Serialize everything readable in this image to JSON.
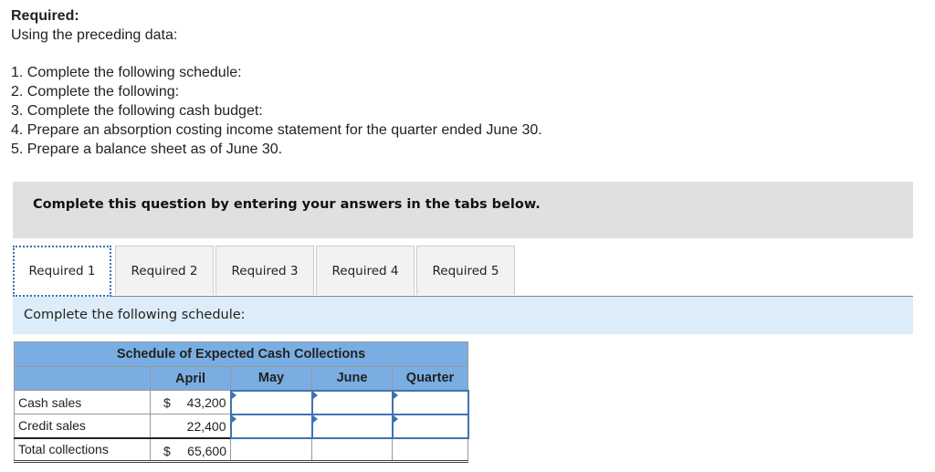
{
  "required": {
    "heading": "Required:",
    "intro": "Using the preceding data:",
    "items": [
      "1. Complete the following schedule:",
      "2. Complete the following:",
      "3. Complete the following cash budget:",
      "4. Prepare an absorption costing income statement for the quarter ended June 30.",
      "5. Prepare a balance sheet as of June 30."
    ]
  },
  "banner": "Complete this question by entering your answers in the tabs below.",
  "tabs": [
    {
      "label": "Required 1",
      "active": true
    },
    {
      "label": "Required 2",
      "active": false
    },
    {
      "label": "Required 3",
      "active": false
    },
    {
      "label": "Required 4",
      "active": false
    },
    {
      "label": "Required 5",
      "active": false
    }
  ],
  "instruction": "Complete the following schedule:",
  "schedule": {
    "title": "Schedule of Expected Cash Collections",
    "columns": [
      "April",
      "May",
      "June",
      "Quarter"
    ],
    "rows": [
      {
        "label": "Cash sales",
        "april_symbol": "$",
        "april": "43,200",
        "may": "",
        "june": "",
        "quarter": ""
      },
      {
        "label": "Credit sales",
        "april_symbol": "",
        "april": "22,400",
        "may": "",
        "june": "",
        "quarter": ""
      },
      {
        "label": "Total collections",
        "april_symbol": "$",
        "april": "65,600",
        "may": "",
        "june": "",
        "quarter": ""
      }
    ]
  },
  "colors": {
    "header_blue": "#7aaee3",
    "strip_blue": "#dcecf8",
    "banner_gray": "#e0e0e0",
    "input_border": "#3f73b3"
  }
}
